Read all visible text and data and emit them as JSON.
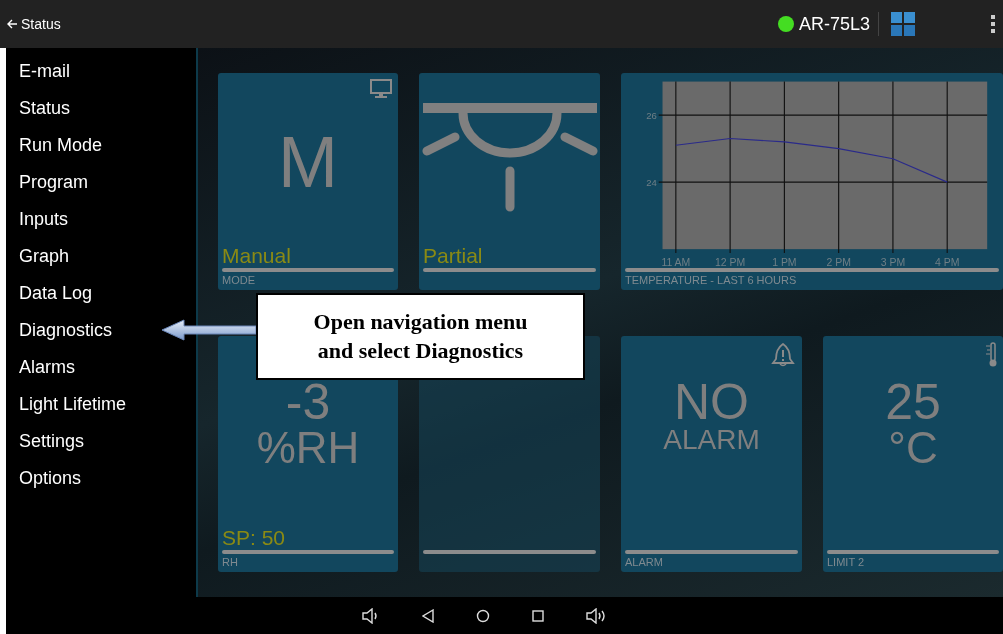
{
  "top_bar": {
    "back_label": "Status",
    "device": "AR-75L3",
    "connected": true
  },
  "nav_menu": {
    "items": [
      "E-mail",
      "Status",
      "Run Mode",
      "Program",
      "Inputs",
      "Graph",
      "Data Log",
      "Diagnostics",
      "Alarms",
      "Light Lifetime",
      "Settings",
      "Options"
    ]
  },
  "tiles": [
    {
      "kind": "text",
      "lines": [
        "M"
      ],
      "status": "Manual",
      "label": "MODE"
    },
    {
      "kind": "light",
      "status": "Partial"
    },
    {
      "kind": "chart",
      "label": "TEMPERATURE - LAST 6 HOURS",
      "chart_data": {
        "type": "line",
        "ylim": [
          22,
          27
        ],
        "yticks": [
          24,
          26
        ],
        "grid": true,
        "categories": [
          "11 AM",
          "12 PM",
          "1 PM",
          "2 PM",
          "3 PM",
          "4 PM"
        ],
        "series": [
          {
            "color": "#2a2a8a",
            "values": [
              25.1,
              25.3,
              25.2,
              25.0,
              24.7,
              24.0
            ]
          }
        ]
      }
    },
    {
      "kind": "text",
      "lines": [
        "-3",
        "%RH"
      ],
      "status": "SP: 50",
      "label": "RH"
    },
    {
      "kind": "empty"
    },
    {
      "kind": "text",
      "lines": [
        "NO",
        "ALARM"
      ],
      "label": "ALARM"
    },
    {
      "kind": "text",
      "lines": [
        "25",
        "°C"
      ],
      "label": "LIMIT 2"
    }
  ],
  "callout": {
    "text": "Open navigation menu and select Diagnostics"
  }
}
